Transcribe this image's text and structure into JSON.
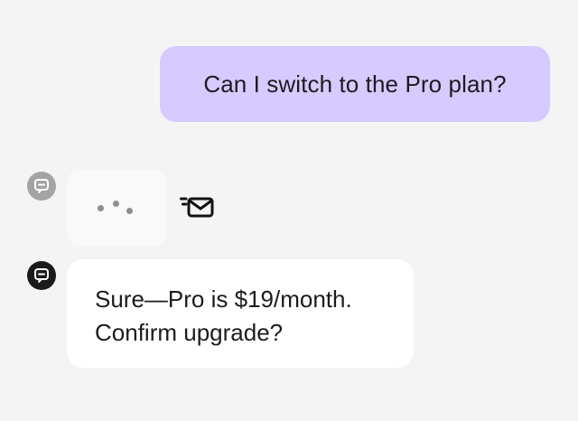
{
  "user_message": {
    "text": "Can I switch to the Pro plan?"
  },
  "typing_indicator": {
    "avatar_icon": "chat-bubble-icon",
    "dots_icon": "typing-dots-icon",
    "status_icon": "send-mail-icon"
  },
  "bot_message": {
    "avatar_icon": "chat-bubble-icon",
    "lines": [
      "Sure—Pro is $19/month.",
      "Confirm upgrade?"
    ]
  },
  "colors": {
    "background": "#f4f4f4",
    "user_bubble": "#d6caff",
    "bot_bubble": "#ffffff",
    "typing_bubble": "#f9f9f9",
    "typing_avatar": "#a4a4a4",
    "bot_avatar": "#1b1b1b"
  }
}
